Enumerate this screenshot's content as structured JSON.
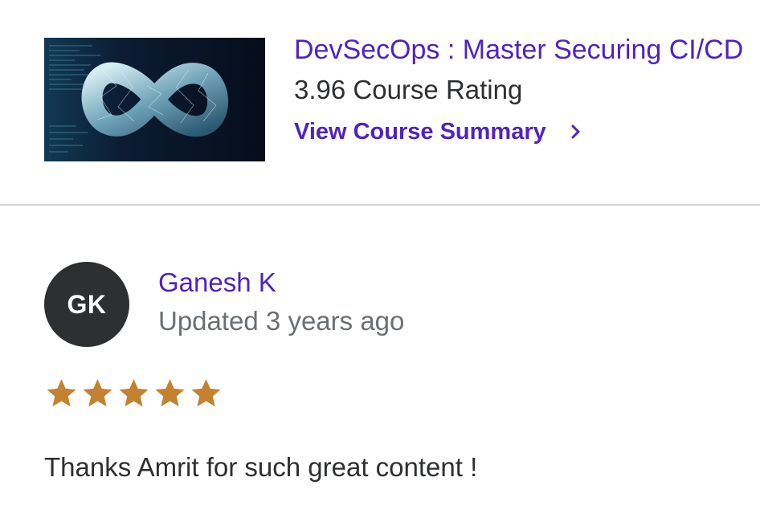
{
  "course": {
    "title": "DevSecOps : Master Securing CI/CD",
    "rating_text": "3.96 Course Rating",
    "summary_link_label": "View Course Summary",
    "link_color": "#5022c3"
  },
  "review": {
    "avatar_initials": "GK",
    "reviewer_name": "Ganesh K",
    "updated_text": "Updated 3 years ago",
    "star_rating": 5,
    "star_color": "#c4812f",
    "comment": "Thanks Amrit for such great content !"
  },
  "icons": {
    "thumbnail": "infinity-devops-icon",
    "summary_link": "chevron-right-icon",
    "rating": "star-icon"
  }
}
